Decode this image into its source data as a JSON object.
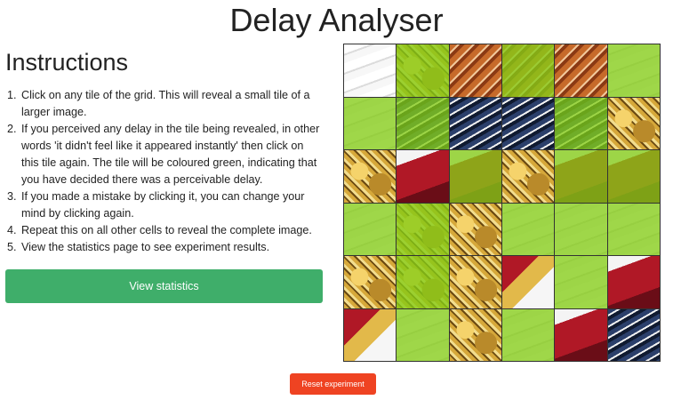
{
  "page": {
    "title": "Delay Analyser"
  },
  "instructions": {
    "heading": "Instructions",
    "steps": [
      "Click on any tile of the grid. This will reveal a small tile of a larger image.",
      "If you perceived any delay in the tile being revealed, in other words 'it didn't feel like it appeared instantly' then click on this tile again. The tile will be coloured green, indicating that you have decided there was a perceivable delay.",
      "If you made a mistake by clicking it, you can change your mind by clicking again.",
      "Repeat this on all other cells to reveal the complete image.",
      "View the statistics page to see experiment results."
    ]
  },
  "buttons": {
    "view_statistics": "View statistics",
    "reset_experiment": "Reset experiment"
  },
  "grid": {
    "rows": 6,
    "cols": 6,
    "tiles": [
      {
        "texture": "t-white",
        "delay": false
      },
      {
        "texture": "t-gold",
        "delay": true
      },
      {
        "texture": "t-roof",
        "delay": false
      },
      {
        "texture": "t-roof",
        "delay": true
      },
      {
        "texture": "t-roof",
        "delay": false
      },
      {
        "texture": "t-white",
        "delay": true
      },
      {
        "texture": "t-white",
        "delay": true
      },
      {
        "texture": "t-roofblue",
        "delay": true
      },
      {
        "texture": "t-roofblue",
        "delay": false
      },
      {
        "texture": "t-roofblue",
        "delay": false
      },
      {
        "texture": "t-roofblue",
        "delay": true
      },
      {
        "texture": "t-gold",
        "delay": false
      },
      {
        "texture": "t-gold",
        "delay": false
      },
      {
        "texture": "t-red",
        "delay": false
      },
      {
        "texture": "t-red",
        "delay": true
      },
      {
        "texture": "t-gold",
        "delay": false
      },
      {
        "texture": "t-red",
        "delay": true
      },
      {
        "texture": "t-red",
        "delay": true
      },
      {
        "texture": "t-white",
        "delay": true
      },
      {
        "texture": "t-gold",
        "delay": true
      },
      {
        "texture": "t-gold",
        "delay": false
      },
      {
        "texture": "t-white",
        "delay": true
      },
      {
        "texture": "t-white",
        "delay": true
      },
      {
        "texture": "t-white",
        "delay": true
      },
      {
        "texture": "t-gold",
        "delay": false
      },
      {
        "texture": "t-gold",
        "delay": true
      },
      {
        "texture": "t-gold",
        "delay": false
      },
      {
        "texture": "t-mix",
        "delay": false
      },
      {
        "texture": "t-white",
        "delay": true
      },
      {
        "texture": "t-red",
        "delay": false
      },
      {
        "texture": "t-mix",
        "delay": false
      },
      {
        "texture": "t-white",
        "delay": true
      },
      {
        "texture": "t-gold",
        "delay": false
      },
      {
        "texture": "t-white",
        "delay": true
      },
      {
        "texture": "t-red",
        "delay": false
      },
      {
        "texture": "t-roofblue",
        "delay": false
      }
    ]
  },
  "colors": {
    "delay_overlay": "#84cc16",
    "view_statistics_bg": "#3fae6a",
    "reset_bg": "#ef4322"
  }
}
